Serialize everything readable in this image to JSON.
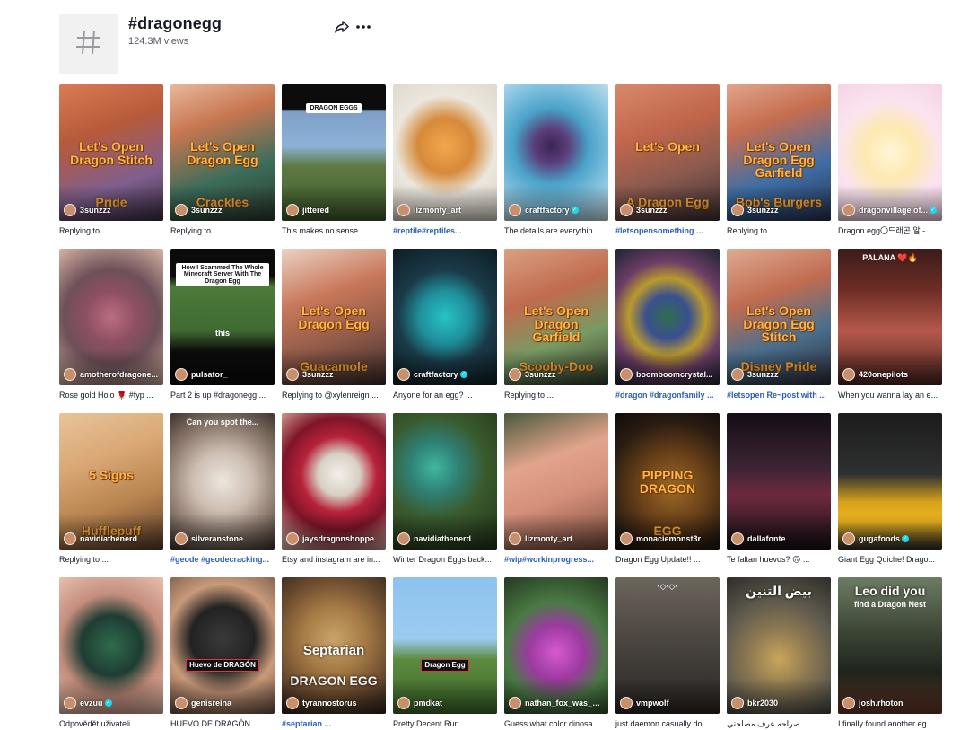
{
  "header": {
    "tag_symbol": "#",
    "title": "#dragonegg",
    "views": "124.3M views",
    "share_icon": "share-icon",
    "more_icon": "more-icon"
  },
  "videos": [
    {
      "creator": "3sunzzz",
      "verified": false,
      "caption": "Replying to ...",
      "caption_hashtag": false,
      "overlay": "Let's Open Dragon Stitch",
      "overlay2": "Pride",
      "style": "yellow",
      "bg": "linear-gradient(160deg,#d97b54 0%,#b75a3a 35%,#7f5f8e 70%,#3b2d44 100%)"
    },
    {
      "creator": "3sunzzz",
      "verified": false,
      "caption": "Replying to ...",
      "caption_hashtag": false,
      "overlay": "Let's Open Dragon Egg",
      "overlay2": "Crackles",
      "style": "yellow",
      "bg": "linear-gradient(160deg,#e8b79c 0%,#c7764f 30%,#3c6d5a 65%,#2a3a2d 100%)"
    },
    {
      "creator": "jittered",
      "verified": false,
      "caption": "This makes no sense ...",
      "caption_hashtag": false,
      "overlay": "DRAGON EGGS",
      "overlay2": "",
      "style": "box",
      "bg": "linear-gradient(180deg,#0c0c0c 0%,#0c0c0c 18%,#7ea0c8 20%,#8db1d6 45%,#5e7a42 60%,#3d5a2a 100%)"
    },
    {
      "creator": "lizmonty_art",
      "verified": false,
      "caption": "#reptile#reptiles...",
      "caption_hashtag": true,
      "overlay": "",
      "overlay2": "",
      "style": "none",
      "bg": "radial-gradient(circle at 50% 45%,#f2a74d 0%,#d68a3a 30%,#ece7de 55%,#d9d3c7 100%)"
    },
    {
      "creator": "craftfactory",
      "verified": true,
      "caption": "The details are everythin...",
      "caption_hashtag": false,
      "overlay": "",
      "overlay2": "",
      "style": "none",
      "bg": "radial-gradient(circle at 45% 45%,#3a2553 0%,#5b3d7a 18%,#4aa3c9 40%,#8fc8e3 70%,#d5e8ef 100%)"
    },
    {
      "creator": "3sunzzz",
      "verified": false,
      "caption": "#letsopensomething ...",
      "caption_hashtag": true,
      "overlay": "Let's Open",
      "overlay2": "A Dragon Egg",
      "style": "yellow",
      "bg": "linear-gradient(160deg,#d8896a 0%,#c1664b 35%,#8a5a4e 65%,#3e2f33 100%)"
    },
    {
      "creator": "3sunzzz",
      "verified": false,
      "caption": "Replying to ...",
      "caption_hashtag": false,
      "overlay": "Let's Open Dragon Egg Garfield",
      "overlay2": "Bob's Burgers",
      "style": "yellow",
      "bg": "linear-gradient(160deg,#e0a58b 0%,#c66d4f 30%,#3e6ea6 65%,#263250 100%)"
    },
    {
      "creator": "dragonvillage.of...",
      "verified": true,
      "caption": "Dragon egg〇드래곤 알 -...",
      "caption_hashtag": false,
      "overlay": "",
      "overlay2": "",
      "style": "none",
      "bg": "radial-gradient(circle at 50% 50%,#fff6d9 0%,#fde9b0 30%,#fbe4ef 60%,#f6d3e4 100%)"
    },
    {
      "creator": "amotherofdragone...",
      "verified": false,
      "caption": "Rose gold Holo 🌹 #fyp ...",
      "caption_hashtag": false,
      "overlay": "",
      "overlay2": "",
      "style": "none",
      "bg": "radial-gradient(circle at 50% 50%,#b86f7f 0%,#8e4f63 30%,#6d5058 55%,#d6b4a4 100%)"
    },
    {
      "creator": "pulsator_",
      "verified": false,
      "caption": "Part 2 is up #dragonegg ...",
      "caption_hashtag": false,
      "overlay": "How I Scammed The Whole Minecraft Server With The Dragon Egg",
      "overlay2": "this",
      "style": "box",
      "bg": "linear-gradient(180deg,#0b0b0b 0%,#0b0b0b 20%,#4c7b3a 28%,#3f6a31 60%,#0b0b0b 75%,#0b0b0b 100%)"
    },
    {
      "creator": "3sunzzz",
      "verified": false,
      "caption": "Replying to @xylenreign ...",
      "caption_hashtag": false,
      "overlay": "Let's Open Dragon Egg",
      "overlay2": "Guacamole",
      "style": "yellow",
      "bg": "linear-gradient(160deg,#ead2c4 0%,#c9785a 35%,#8f5a48 65%,#3b2b2a 100%)"
    },
    {
      "creator": "craftfactory",
      "verified": true,
      "caption": "Anyone for an egg? ...",
      "caption_hashtag": false,
      "overlay": "",
      "overlay2": "",
      "style": "none",
      "bg": "radial-gradient(circle at 50% 50%,#27c4c6 0%,#1e8f9b 30%,#1b3a48 55%,#0d1c24 100%)"
    },
    {
      "creator": "3sunzzz",
      "verified": false,
      "caption": "Replying to ...",
      "caption_hashtag": false,
      "overlay": "Let's Open Dragon Garfield",
      "overlay2": "Scooby-Doo",
      "style": "yellow",
      "bg": "linear-gradient(160deg,#dba083 0%,#c06b4e 35%,#7a9a63 65%,#2f3a2c 100%)"
    },
    {
      "creator": "boomboomcrystal...",
      "verified": false,
      "caption": "#dragon #dragonfamily ...",
      "caption_hashtag": true,
      "overlay": "",
      "overlay2": "",
      "style": "none",
      "bg": "radial-gradient(circle at 50% 50%,#2f6d4f 0%,#3b4f8f 25%,#b89a2f 45%,#6c3d66 65%,#1c2430 100%)"
    },
    {
      "creator": "3sunzzz",
      "verified": false,
      "caption": "#letsopen Re~post with ...",
      "caption_hashtag": true,
      "overlay": "Let's Open Dragon Egg Stitch",
      "overlay2": "Disney Pride",
      "style": "yellow",
      "bg": "linear-gradient(160deg,#dfab92 0%,#c06c50 35%,#4b6f8c 65%,#2a2d3c 100%)"
    },
    {
      "creator": "420onepilots",
      "verified": false,
      "caption": "When you wanna lay an e...",
      "caption_hashtag": false,
      "overlay": "PALANA ❤️🔥",
      "overlay2": "",
      "style": "whitesmall",
      "bg": "linear-gradient(180deg,#3b1c1a 0%,#6d2d26 30%,#b5584a 60%,#4a241f 100%)"
    },
    {
      "creator": "navidiathenerd",
      "verified": false,
      "caption": "Replying to ...",
      "caption_hashtag": false,
      "overlay": "5 Signs",
      "overlay2": "Hufflepuff",
      "style": "yellow",
      "bg": "linear-gradient(160deg,#e8c49a 0%,#d9a774 35%,#b8834f 65%,#5a3d2a 100%)"
    },
    {
      "creator": "silveranstone",
      "verified": false,
      "caption": "#geode #geodecracking...",
      "caption_hashtag": true,
      "overlay": "Can you spot the...",
      "overlay2": "",
      "style": "whitesmall",
      "bg": "radial-gradient(circle at 50% 50%,#ece6df 0%,#cdbdb1 35%,#8c7a6d 65%,#3f342e 100%)"
    },
    {
      "creator": "jaysdragonshoppe",
      "verified": false,
      "caption": "Etsy and instagram are in...",
      "caption_hashtag": false,
      "overlay": "",
      "overlay2": "",
      "style": "none",
      "bg": "radial-gradient(circle at 55% 45%,#f3f0ea 0%,#d8d0c4 22%,#b7223a 40%,#7e1528 60%,#e8c8b8 100%)"
    },
    {
      "creator": "navidiathenerd",
      "verified": false,
      "caption": "Winter Dragon Eggs back...",
      "caption_hashtag": false,
      "overlay": "",
      "overlay2": "",
      "style": "none",
      "bg": "radial-gradient(circle at 40% 40%,#3fb7a0 0%,#2f7f73 25%,#3a5a2d 50%,#1f3219 100%)"
    },
    {
      "creator": "lizmonty_art",
      "verified": false,
      "caption": "#wip#workinprogress...",
      "caption_hashtag": true,
      "overlay": "",
      "overlay2": "",
      "style": "none",
      "bg": "linear-gradient(160deg,#4a5a3c 0%,#e1a48c 35%,#d5907a 60%,#7a4c3e 100%)"
    },
    {
      "creator": "monaciemonst3r",
      "verified": false,
      "caption": "Dragon Egg Update!! ...",
      "caption_hashtag": false,
      "overlay": "PIPPING DRAGON",
      "overlay2": "EGG",
      "style": "yellow",
      "bg": "radial-gradient(circle at 55% 55%,#9b6a2a 0%,#6d4318 35%,#2a1c12 70%,#0f0b08 100%)"
    },
    {
      "creator": "dallafonte",
      "verified": false,
      "caption": "Te faltan huevos? 🙃 ...",
      "caption_hashtag": false,
      "overlay": "",
      "overlay2": "",
      "style": "none",
      "bg": "linear-gradient(180deg,#140e16 0%,#3c2434 40%,#6d2a3e 60%,#161015 100%)"
    },
    {
      "creator": "gugafoods",
      "verified": true,
      "caption": "Giant Egg Quiche! Drago...",
      "caption_hashtag": false,
      "overlay": "",
      "overlay2": "",
      "style": "none",
      "bg": "linear-gradient(180deg,#1c1c1c 0%,#2f3030 45%,#d6a11d 65%,#f0b820 80%,#2a2a2a 100%)"
    },
    {
      "creator": "evzuu",
      "verified": true,
      "caption": "Odpovědět uživateli ...",
      "caption_hashtag": false,
      "overlay": "",
      "overlay2": "",
      "style": "none",
      "bg": "radial-gradient(circle at 50% 50%,#2f6b4c 0%,#1e3d33 35%,#c48d7c 60%,#e8bfae 100%)"
    },
    {
      "creator": "genisreina",
      "verified": false,
      "caption": "HUEVO DE DRAGÓN",
      "caption_hashtag": false,
      "overlay": "Huevo de DRAGÓN",
      "overlay2": "",
      "style": "redbox",
      "bg": "radial-gradient(circle at 50% 45%,#3a3a3a 0%,#222 35%,#c99a7a 60%,#6b5040 100%)"
    },
    {
      "creator": "tyrannostorus",
      "verified": false,
      "caption": "#septarian ...",
      "caption_hashtag": true,
      "overlay": "Septarian",
      "overlay2": "DRAGON EGG",
      "style": "septa",
      "bg": "radial-gradient(circle at 50% 45%,#c9a36a 0%,#a47a45 35%,#6d4c2f 65%,#2a221d 100%)"
    },
    {
      "creator": "pmdkat",
      "verified": false,
      "caption": "Pretty Decent Run ...",
      "caption_hashtag": false,
      "overlay": "Dragon Egg",
      "overlay2": "",
      "style": "redbox",
      "bg": "linear-gradient(180deg,#8ec3ef 0%,#9ccbf1 45%,#5c8b3f 60%,#3e6a2b 100%)"
    },
    {
      "creator": "nathan_fox_was_he...",
      "verified": false,
      "caption": "Guess what color dinosa...",
      "caption_hashtag": false,
      "overlay": "",
      "overlay2": "",
      "style": "none",
      "bg": "radial-gradient(circle at 50% 55%,#d45bd0 0%,#9c3aa0 30%,#4a7a45 55%,#24391f 100%)"
    },
    {
      "creator": "vmpwolf",
      "verified": false,
      "caption": "just daemon casually doi...",
      "caption_hashtag": false,
      "overlay": "·◇·◇·",
      "overlay2": "",
      "style": "whitesmall",
      "bg": "linear-gradient(180deg,#6c655c 0%,#4b4640 45%,#2a2623 100%)"
    },
    {
      "creator": "bkr2030",
      "verified": false,
      "caption": "صراحه عرف مصلحتي ...",
      "caption_hashtag": false,
      "overlay": "بيض التنين",
      "overlay2": "",
      "style": "whitebig",
      "bg": "radial-gradient(circle at 50% 60%,#caa65a 0%,#8f7a52 30%,#5e5a4e 60%,#2e2c28 100%)"
    },
    {
      "creator": "josh.rhoton",
      "verified": false,
      "caption": "I finally found another eg...",
      "caption_hashtag": false,
      "overlay": "Leo did you",
      "overlay2": "find a Dragon Nest",
      "style": "whitebig",
      "bg": "linear-gradient(180deg,#6d7c63 0%,#3b4535 40%,#1e231b 70%,#6a3a2a 100%)"
    }
  ]
}
